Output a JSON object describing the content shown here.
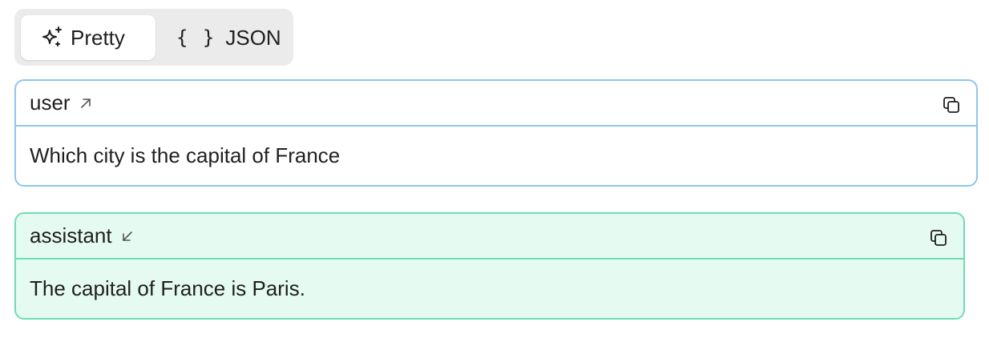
{
  "view_toggle": {
    "pretty_label": "Pretty",
    "json_label": "JSON",
    "json_icon_text": "{ }",
    "active": "pretty"
  },
  "messages": [
    {
      "role": "user",
      "direction_icon": "arrow-up-right-icon",
      "content": "Which city is the capital of France"
    },
    {
      "role": "assistant",
      "direction_icon": "arrow-down-left-icon",
      "content": "The capital of France is Paris."
    }
  ],
  "colors": {
    "user_border": "#8ec5ee",
    "assistant_border": "#6fdcb2",
    "assistant_background": "#e5fbf1",
    "toggle_background": "#ebebeb"
  }
}
